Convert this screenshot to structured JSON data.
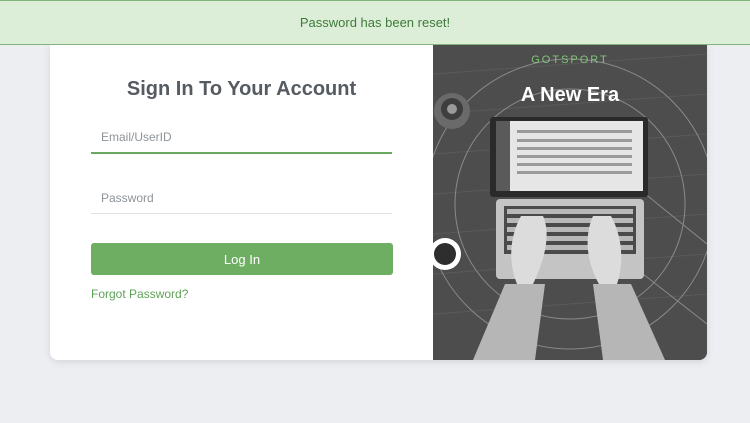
{
  "banner": {
    "message": "Password has been reset!"
  },
  "login": {
    "title": "Sign In To Your Account",
    "email_placeholder": "Email/UserID",
    "email_value": "",
    "password_placeholder": "Password",
    "password_value": "",
    "login_label": "Log In",
    "forgot_label": "Forgot Password?"
  },
  "promo": {
    "brand": "GOTSPORT",
    "headline": "A New Era",
    "image_icon": "laptop-typing-photo"
  },
  "colors": {
    "accent": "#6dae63",
    "banner_bg": "#dcedd8",
    "banner_text": "#3f7b3a",
    "brand": "#7fc477"
  }
}
